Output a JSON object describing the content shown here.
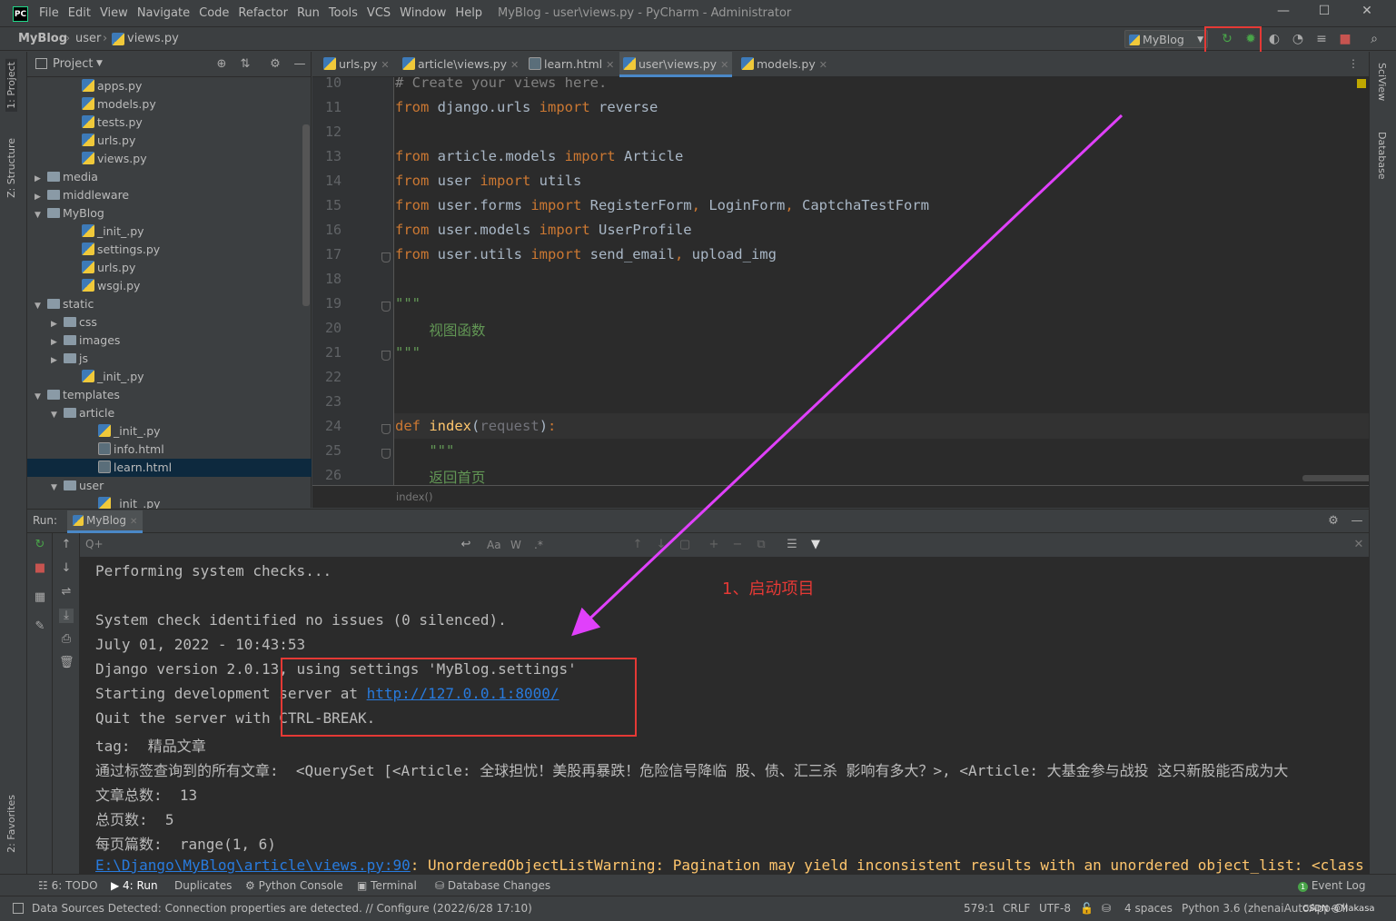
{
  "titlebar": {
    "logo": "PC",
    "menus": [
      "File",
      "Edit",
      "View",
      "Navigate",
      "Code",
      "Refactor",
      "Run",
      "Tools",
      "VCS",
      "Window",
      "Help"
    ],
    "title": "MyBlog - user\\views.py - PyCharm - Administrator"
  },
  "navbar": {
    "crumbs": [
      "MyBlog",
      "user",
      "views.py"
    ],
    "run_config": "MyBlog"
  },
  "left_stripe": {
    "project_tab": "1: Project",
    "structure_tab": "Z: Structure",
    "favorites_tab": "2: Favorites"
  },
  "right_stripe": {
    "sciview_tab": "SciView",
    "database_tab": "Database"
  },
  "project_panel": {
    "title": "Project",
    "tree": [
      {
        "label": "apps.py",
        "type": "py",
        "depth": 3
      },
      {
        "label": "models.py",
        "type": "py",
        "depth": 3
      },
      {
        "label": "tests.py",
        "type": "py",
        "depth": 3
      },
      {
        "label": "urls.py",
        "type": "py",
        "depth": 3
      },
      {
        "label": "views.py",
        "type": "py",
        "depth": 3
      },
      {
        "label": "media",
        "type": "dir",
        "depth": 1,
        "arrow": "▶"
      },
      {
        "label": "middleware",
        "type": "dir",
        "depth": 1,
        "arrow": "▶"
      },
      {
        "label": "MyBlog",
        "type": "dir",
        "depth": 1,
        "arrow": "▼"
      },
      {
        "label": "_init_.py",
        "type": "py",
        "depth": 3
      },
      {
        "label": "settings.py",
        "type": "py",
        "depth": 3
      },
      {
        "label": "urls.py",
        "type": "py",
        "depth": 3
      },
      {
        "label": "wsgi.py",
        "type": "py",
        "depth": 3
      },
      {
        "label": "static",
        "type": "dir",
        "depth": 1,
        "arrow": "▼"
      },
      {
        "label": "css",
        "type": "dir",
        "depth": 2,
        "arrow": "▶"
      },
      {
        "label": "images",
        "type": "dir",
        "depth": 2,
        "arrow": "▶"
      },
      {
        "label": "js",
        "type": "dir",
        "depth": 2,
        "arrow": "▶"
      },
      {
        "label": "_init_.py",
        "type": "py",
        "depth": 3
      },
      {
        "label": "templates",
        "type": "dir",
        "depth": 1,
        "arrow": "▼"
      },
      {
        "label": "article",
        "type": "dir",
        "depth": 2,
        "arrow": "▼"
      },
      {
        "label": "_init_.py",
        "type": "py",
        "depth": 4
      },
      {
        "label": "info.html",
        "type": "html",
        "depth": 4
      },
      {
        "label": "learn.html",
        "type": "html",
        "depth": 4,
        "selected": true
      },
      {
        "label": "user",
        "type": "dir",
        "depth": 2,
        "arrow": "▼"
      },
      {
        "label": "_init_.py",
        "type": "py",
        "depth": 4
      }
    ]
  },
  "editor": {
    "tabs": [
      {
        "label": "urls.py",
        "active": false
      },
      {
        "label": "article\\views.py",
        "active": false
      },
      {
        "label": "learn.html",
        "active": false
      },
      {
        "label": "user\\views.py",
        "active": true
      },
      {
        "label": "models.py",
        "active": false
      }
    ],
    "lines": [
      {
        "n": "10",
        "html": "<span class=\"cm\"># Create your views here.</span>"
      },
      {
        "n": "11",
        "html": "<span class=\"kw\">from</span> django.urls <span class=\"kw\">import</span> reverse"
      },
      {
        "n": "12",
        "html": ""
      },
      {
        "n": "13",
        "html": "<span class=\"kw\">from</span> article.models <span class=\"kw\">import</span> Article"
      },
      {
        "n": "14",
        "html": "<span class=\"kw\">from</span> user <span class=\"kw\">import</span> utils"
      },
      {
        "n": "15",
        "html": "<span class=\"kw\">from</span> user.forms <span class=\"kw\">import</span> RegisterForm<span class=\"kw\">,</span> LoginForm<span class=\"kw\">,</span> CaptchaTestForm"
      },
      {
        "n": "16",
        "html": "<span class=\"kw\">from</span> user.models <span class=\"kw\">import</span> UserProfile"
      },
      {
        "n": "17",
        "html": "<span class=\"kw\">from</span> user.utils <span class=\"kw\">import</span> send_email<span class=\"kw\">,</span> upload_img"
      },
      {
        "n": "18",
        "html": ""
      },
      {
        "n": "19",
        "html": "<span class=\"doc\">\"\"\"</span>"
      },
      {
        "n": "20",
        "html": "<span class=\"doc\">    视图函数</span>"
      },
      {
        "n": "21",
        "html": "<span class=\"doc\">\"\"\"</span>"
      },
      {
        "n": "22",
        "html": ""
      },
      {
        "n": "23",
        "html": ""
      },
      {
        "n": "24",
        "html": "<span class=\"kw\">def</span> <span class=\"fn\">index</span>(<span class=\"param\">request</span>)<span class=\"kw\">:</span>"
      },
      {
        "n": "25",
        "html": "    <span class=\"doc\">\"\"\"</span>"
      },
      {
        "n": "26",
        "html": "    <span class=\"doc\">返回首页</span>"
      }
    ],
    "breadcrumb": "index()"
  },
  "run_panel": {
    "label": "Run:",
    "tab": "MyBlog",
    "search_placeholder": "Q+",
    "search_opts": [
      "Aa",
      "W",
      ".*"
    ],
    "console": [
      {
        "t": "Performing system checks..."
      },
      {
        "t": ""
      },
      {
        "t": "System check identified no issues (0 silenced)."
      },
      {
        "t": "July 01, 2022 - 10:43:53"
      },
      {
        "t": "Django version 2.0.13, using settings 'MyBlog.settings'"
      },
      {
        "t": "Starting development server at ",
        "link": "http://127.0.0.1:8000/"
      },
      {
        "t": "Quit the server with CTRL-BREAK."
      },
      {
        "t": "tag:  精品文章"
      },
      {
        "t": "通过标签查询到的所有文章:  <QuerySet [<Article: 全球担忧！美股再暴跌！危险信号降临 股、债、汇三杀 影响有多大？>, <Article: 大基金参与战投 这只新股能否成为大"
      },
      {
        "t": "文章总数:  13"
      },
      {
        "t": "总页数:  5"
      },
      {
        "t": "每页篇数:  range(1, 6)"
      },
      {
        "link2": "E:\\Django\\MyBlog\\article\\views.py:90",
        "warn": ": UnorderedObjectListWarning: Pagination may yield inconsistent results with an unordered object_list: <class 'article.m"
      }
    ]
  },
  "annotation": {
    "text": "1、启动项目"
  },
  "toolstrip": {
    "items": [
      "6: TODO",
      "4: Run",
      "Duplicates",
      "Python Console",
      "Terminal",
      "Database Changes"
    ],
    "event_log": "Event Log"
  },
  "statusbar": {
    "message": "Data Sources Detected: Connection properties are detected. // Configure (2022/6/28 17:10)",
    "position": "579:1",
    "line_sep": "CRLF",
    "encoding": "UTF-8",
    "indent": "4 spaces",
    "interpreter": "Python 3.6 (zhenaiAutoApp-Cli",
    "watermark": "CSDN @Makasa"
  },
  "colors": {
    "accent": "#4a88c7",
    "highlight_red": "#e53935",
    "arrow_magenta": "#e040fb",
    "run_green": "#49a449"
  }
}
